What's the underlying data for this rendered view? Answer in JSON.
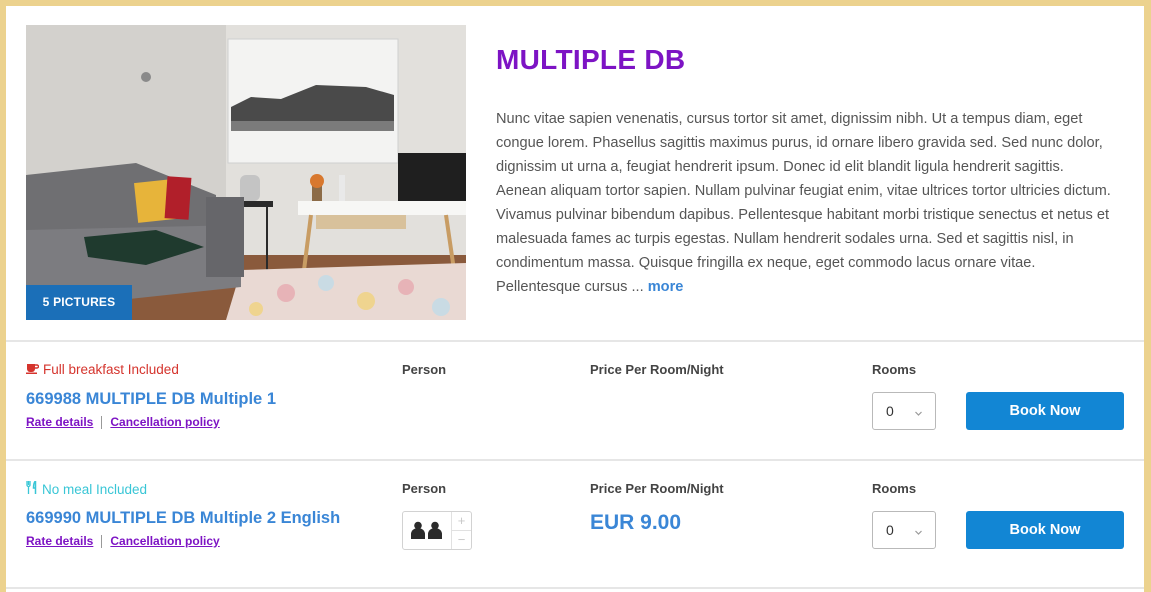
{
  "room": {
    "title": "MULTIPLE DB",
    "pictures_label": "5 PICTURES",
    "description": "Nunc vitae sapien venenatis, cursus tortor sit amet, dignissim nibh. Ut a tempus diam, eget congue lorem. Phasellus sagittis maximus purus, id ornare libero gravida sed. Sed nunc dolor, dignissim ut urna a, feugiat hendrerit ipsum. Donec id elit blandit ligula hendrerit sagittis. Aenean aliquam tortor sapien. Nullam pulvinar feugiat enim, vitae ultrices tortor ultricies dictum. Vivamus pulvinar bibendum dapibus. Pellentesque habitant morbi tristique senectus et netus et malesuada fames ac turpis egestas. Nullam hendrerit sodales urna. Sed et sagittis nisl, in condimentum massa. Quisque fringilla ex neque, eget commodo lacus ornare vitae. Pellentesque cursus ...",
    "more_label": "more"
  },
  "rates": [
    {
      "meal_icon": "coffee-cup-icon",
      "meal_color": "#d5342d",
      "meal": "Full breakfast Included",
      "name": "669988 MULTIPLE DB Multiple 1",
      "rate_details": "Rate details",
      "cancellation": "Cancellation policy",
      "person_label": "Person",
      "price_label": "Price Per Room/Night",
      "rooms_label": "Rooms",
      "rooms_value": "0",
      "book_label": "Book Now"
    },
    {
      "meal_icon": "fork-knife-icon",
      "meal_color": "#39c6d6",
      "meal": "No meal Included",
      "name": "669990 MULTIPLE DB Multiple 2 English",
      "rate_details": "Rate details",
      "cancellation": "Cancellation policy",
      "person_label": "Person",
      "persons_icon": "two-persons-icon",
      "stepper_plus": "+",
      "stepper_minus": "−",
      "price_label": "Price Per Room/Night",
      "price": "EUR 9.00",
      "rooms_label": "Rooms",
      "rooms_value": "0",
      "book_label": "Book Now"
    }
  ],
  "colors": {
    "accent_blue": "#1286d4",
    "title_purple": "#7d13c4",
    "frame_gold": "#ecd28e"
  }
}
